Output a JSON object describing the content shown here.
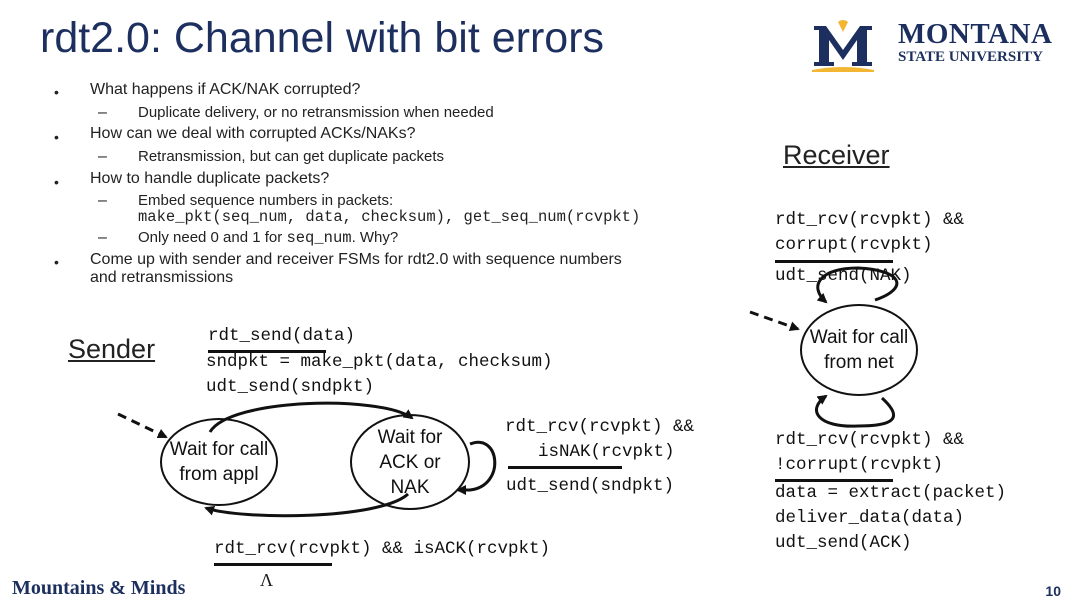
{
  "slide": {
    "title": "rdt2.0: Channel with bit errors",
    "bullets": [
      {
        "text": "What happens if ACK/NAK corrupted?"
      },
      {
        "sub": "Duplicate delivery, or no retransmission when needed"
      },
      {
        "text": "How can we deal with corrupted ACKs/NAKs?"
      },
      {
        "sub": "Retransmission, but can get duplicate packets"
      },
      {
        "text": "How to handle duplicate packets?"
      },
      {
        "sub": "Embed sequence numbers in packets:"
      },
      {
        "sub_code": "make_pkt(seq_num, data, checksum), get_seq_num(rcvpkt)"
      },
      {
        "sub_a": "Only need 0 and 1 for ",
        "sub_code": "seq_num",
        "sub_b": ". Why?"
      },
      {
        "text": "Come up with sender and receiver FSMs for rdt2.0 with sequence numbers"
      },
      {
        "text_cont": "and retransmissions"
      }
    ],
    "bullet_glyph": "•",
    "dash_glyph": "–",
    "logo": {
      "line1": "MONTANA",
      "line2": "STATE UNIVERSITY",
      "brand_color": "#1c2f5e",
      "gold": "#f2b632"
    },
    "footer": "Mountains & Minds",
    "page_number": "10"
  },
  "sender": {
    "heading": "Sender",
    "state_wait_call": [
      "Wait for call",
      "from appl"
    ],
    "state_wait_ack": [
      "Wait for",
      "ACK or",
      "NAK"
    ],
    "t1_event": "rdt_send(data)",
    "t1_actions": [
      "sndpkt = make_pkt(data, checksum)",
      "udt_send(sndpkt)"
    ],
    "t2_event": [
      "rdt_rcv(rcvpkt) &&",
      "isNAK(rcvpkt)"
    ],
    "t2_action": "udt_send(sndpkt)",
    "t3_event": "rdt_rcv(rcvpkt) && isACK(rcvpkt)",
    "t3_action": "Λ"
  },
  "receiver": {
    "heading": "Receiver",
    "state": [
      "Wait for call",
      "from net"
    ],
    "t1_event": [
      "rdt_rcv(rcvpkt) &&",
      "corrupt(rcvpkt)"
    ],
    "t1_action": "udt_send(NAK)",
    "t2_event": [
      "rdt_rcv(rcvpkt) &&",
      "!corrupt(rcvpkt)"
    ],
    "t2_actions": [
      "data = extract(packet)",
      "deliver_data(data)",
      "udt_send(ACK)"
    ]
  }
}
